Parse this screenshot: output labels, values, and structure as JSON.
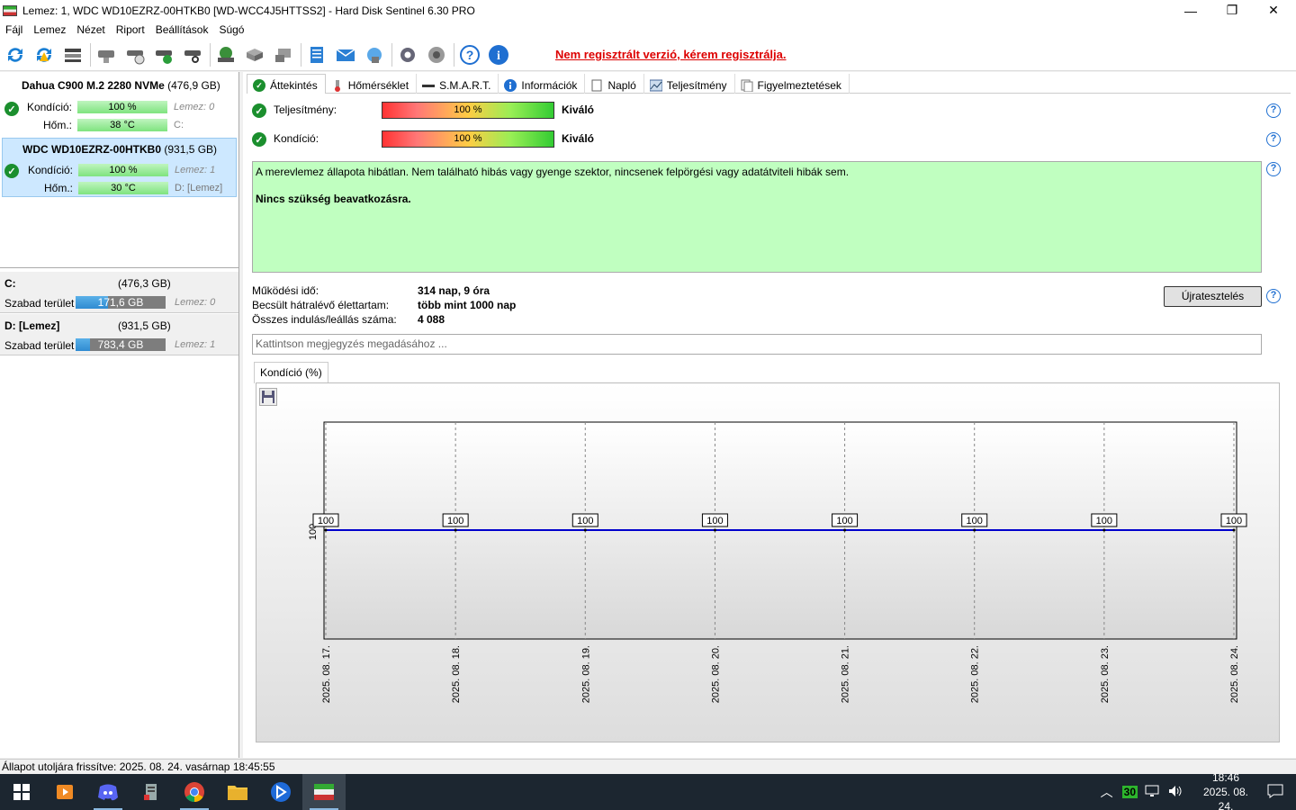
{
  "window": {
    "title": "Lemez: 1, WDC WD10EZRZ-00HTKB0 [WD-WCC4J5HTTSS2]  -  Hard Disk Sentinel 6.30 PRO",
    "min": "—",
    "max": "❐",
    "close": "✕"
  },
  "menu": [
    "Fájl",
    "Lemez",
    "Nézet",
    "Riport",
    "Beállítások",
    "Súgó"
  ],
  "toolbar": {
    "unregistered": "Nem regisztrált verzió, kérem regisztrálja."
  },
  "disks": [
    {
      "name": "Dahua C900 M.2 2280 NVMe",
      "size": "(476,9 GB)",
      "condition_label": "Kondíció:",
      "condition": "100 %",
      "condition_side": "Lemez: 0",
      "temp_label": "Hőm.:",
      "temp": "38 °C",
      "temp_side": "C:"
    },
    {
      "name": "WDC WD10EZRZ-00HTKB0",
      "size": "(931,5 GB)",
      "condition_label": "Kondíció:",
      "condition": "100 %",
      "condition_side": "Lemez: 1",
      "temp_label": "Hőm.:",
      "temp": "30 °C",
      "temp_side": "D: [Lemez]"
    }
  ],
  "volumes": [
    {
      "name": "C:",
      "size": "(476,3 GB)",
      "free_label": "Szabad terület",
      "free": "171,6 GB",
      "free_fraction": 0.36,
      "disk": "Lemez: 0"
    },
    {
      "name": "D: [Lemez]",
      "size": "(931,5 GB)",
      "free_label": "Szabad terület",
      "free": "783,4 GB",
      "free_fraction": 0.16,
      "disk": "Lemez: 1"
    }
  ],
  "tabs": [
    "Áttekintés",
    "Hőmérséklet",
    "S.M.A.R.T.",
    "Információk",
    "Napló",
    "Teljesítmény",
    "Figyelmeztetések"
  ],
  "overview": {
    "performance_label": "Teljesítmény:",
    "performance_value": "100 %",
    "performance_text": "Kiváló",
    "health_label": "Kondíció:",
    "health_value": "100 %",
    "health_text": "Kiváló",
    "status_text": "A merevlemez állapota hibátlan. Nem található hibás vagy gyenge szektor, nincsenek felpörgési vagy adatátviteli hibák sem.",
    "action_text": "Nincs szükség beavatkozásra.",
    "uptime_label": "Működési idő:",
    "uptime": "314 nap, 9 óra",
    "remaining_label": "Becsült hátralévő élettartam:",
    "remaining": "több mint 1000 nap",
    "starts_label": "Összes indulás/leállás száma:",
    "starts": "4 088",
    "retest_button": "Újratesztelés",
    "note_placeholder": "Kattintson megjegyzés megadásához ...",
    "help": "?"
  },
  "chart_tab": "Kondíció  (%)",
  "chart_data": {
    "type": "line",
    "categories": [
      "2025. 08. 17.",
      "2025. 08. 18.",
      "2025. 08. 19.",
      "2025. 08. 20.",
      "2025. 08. 21.",
      "2025. 08. 22.",
      "2025. 08. 23.",
      "2025. 08. 24."
    ],
    "values": [
      100,
      100,
      100,
      100,
      100,
      100,
      100,
      100
    ],
    "y_tick": "100",
    "ylim": [
      0,
      200
    ],
    "grid": true,
    "line_color": "#0000cc"
  },
  "statusbar": "Állapot utoljára frissítve: 2025. 08. 24. vasárnap 18:45:55",
  "taskbar": {
    "tray_badge": "30",
    "time": "18:46",
    "date": "2025. 08. 24."
  }
}
